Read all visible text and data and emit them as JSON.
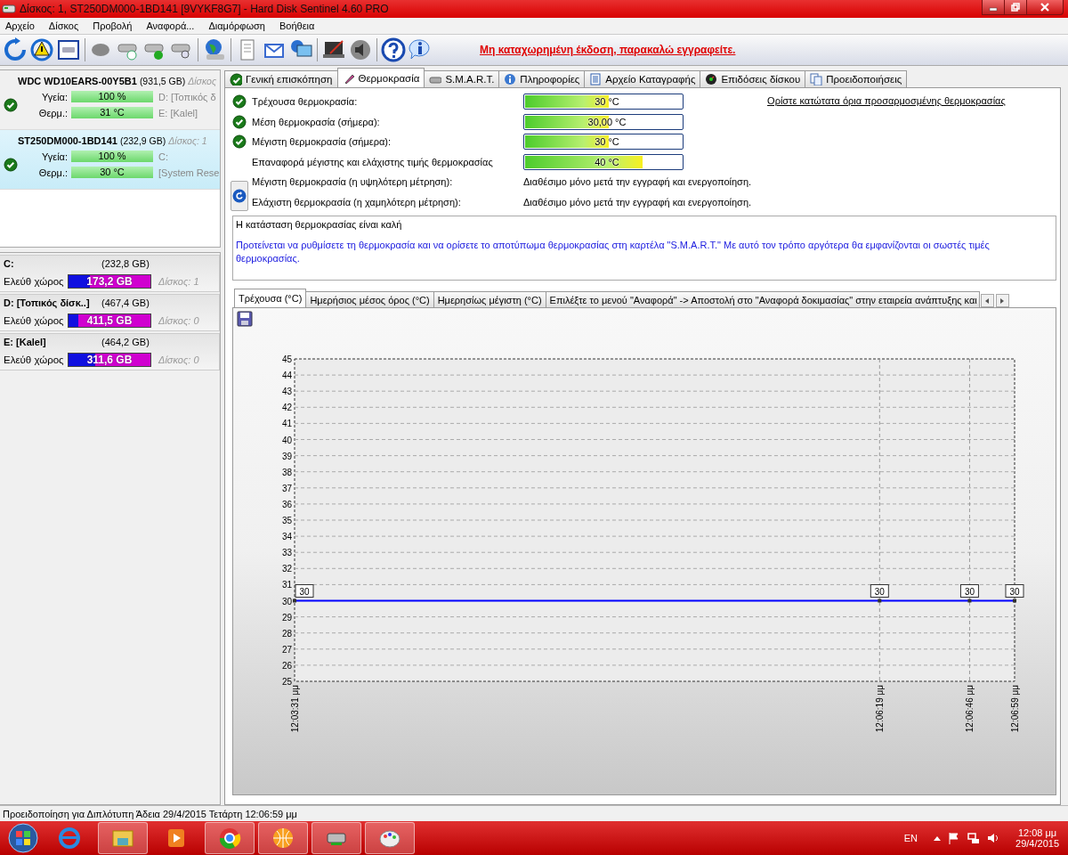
{
  "window": {
    "title": "Δίσκος: 1, ST250DM000-1BD141 [9VYKF8G7]  -  Hard Disk Sentinel 4.60 PRO"
  },
  "menu": [
    "Αρχείο",
    "Δίσκος",
    "Προβολή",
    "Αναφορά...",
    "Διαμόρφωση",
    "Βοήθεια"
  ],
  "toolbar": {
    "notice": "Μη καταχωρημένη έκδοση, παρακαλώ εγγραφείτε."
  },
  "disks": [
    {
      "name": "WDC WD10EARS-00Y5B1",
      "size": "(931,5 GB)",
      "disk": "Δίσκος",
      "selected": false,
      "healthy": true,
      "health_label": "Υγεία:",
      "health": "100 %",
      "temp_label": "Θερμ.:",
      "temp": "31 °C",
      "partitions": [
        "D: [Τοπικός δ",
        "E: [Kalel]"
      ]
    },
    {
      "name": "ST250DM000-1BD141",
      "size": "(232,9 GB)",
      "disk": "Δίσκος: 1",
      "selected": true,
      "healthy": true,
      "health_label": "Υγεία:",
      "health": "100 %",
      "temp_label": "Θερμ.:",
      "temp": "30 °C",
      "partitions": [
        "C:",
        "[System Rese"
      ]
    }
  ],
  "volumes": [
    {
      "name": "C:",
      "size": "(232,8 GB)",
      "free_label": "Ελεύθ χώρος",
      "free": "173,2 GB",
      "level": 0.26,
      "disk": "Δίσκος: 1"
    },
    {
      "name": "D: [Τοπικός δίσκ..]",
      "size": "(467,4 GB)",
      "free_label": "Ελεύθ χώρος",
      "free": "411,5 GB",
      "level": 0.12,
      "disk": "Δίσκος: 0"
    },
    {
      "name": "E: [Kalel]",
      "size": "(464,2 GB)",
      "free_label": "Ελεύθ χώρος",
      "free": "311,6 GB",
      "level": 0.33,
      "disk": "Δίσκος: 0"
    }
  ],
  "tabs": [
    {
      "label": "Γενική επισκόπηση",
      "selected": false
    },
    {
      "label": "Θερμοκρασία",
      "selected": true
    },
    {
      "label": "S.M.A.R.T.",
      "selected": false
    },
    {
      "label": "Πληροφορίες",
      "selected": false
    },
    {
      "label": "Αρχείο Καταγραφής",
      "selected": false
    },
    {
      "label": "Επιδόσεις δίσκου",
      "selected": false
    },
    {
      "label": "Προειδοποιήσεις",
      "selected": false
    }
  ],
  "temperature": {
    "rows": [
      {
        "kind": "bar",
        "healthy": true,
        "label": "Τρέχουσα θερμοκρασία:",
        "value": "30 °C",
        "level": 0.53
      },
      {
        "kind": "bar",
        "healthy": true,
        "label": "Μέση θερμοκρασία (σήμερα):",
        "value": "30,00 °C",
        "level": 0.53
      },
      {
        "kind": "bar",
        "healthy": true,
        "label": "Μέγιστη θερμοκρασία (σήμερα):",
        "value": "30 °C",
        "level": 0.53
      },
      {
        "kind": "bar",
        "healthy": false,
        "label": "Επαναφορά μέγιστης και ελάχιστης τιμής θερμοκρασίας",
        "value": "40 °C",
        "level": 0.74
      },
      {
        "kind": "text",
        "label": "Μέγιστη θερμοκρασία (η υψηλότερη μέτρηση):",
        "value": "Διαθέσιμο μόνο μετά την εγγραφή και ενεργοποίηση."
      },
      {
        "kind": "text",
        "label": "Ελάχιστη θερμοκρασία (η χαμηλότερη μέτρηση):",
        "value": "Διαθέσιμο μόνο μετά την εγγραφή και ενεργοποίηση."
      }
    ],
    "limits_link": "Ορίστε κατώτατα όρια προσαρμοσμένης θερμοκρασίας",
    "status_text": "Η κατάσταση θερμοκρασίας είναι καλή",
    "advice": "Προτείνεται να ρυθμίσετε τη θερμοκρασία και να ορίσετε το αποτύπωμα θερμοκρασίας στη καρτέλα \"S.M.A.R.T.\" Με αυτό τον τρόπο αργότερα θα εμφανίζονται οι σωστές τιμές θερμοκρασίας."
  },
  "chart_tabs": [
    {
      "label": "Τρέχουσα (°C)",
      "selected": true
    },
    {
      "label": "Ημερήσιος μέσος όρος (°C)",
      "selected": false
    },
    {
      "label": "Ημερησίως μέγιστη (°C)",
      "selected": false
    },
    {
      "label": "Επιλέξτε το μενού \"Αναφορά\" -> Αποστολή στο \"Αναφορά δοκιμασίας\" στην εταιρεία ανάπτυξης και",
      "selected": false
    }
  ],
  "chart_data": {
    "type": "line",
    "categories": [
      "12:03:31 μμ",
      null,
      null,
      null,
      null,
      null,
      null,
      null,
      null,
      null,
      null,
      null,
      null,
      "12:06:19 μμ",
      null,
      "12:06:46 μμ",
      "12:06:59 μμ"
    ],
    "series": [
      {
        "color": "#0000ff",
        "marker": "square",
        "values": [
          30,
          null,
          null,
          null,
          null,
          null,
          null,
          null,
          null,
          null,
          null,
          null,
          null,
          30,
          null,
          30,
          30
        ]
      }
    ],
    "ylim": [
      25,
      45
    ],
    "grid": true,
    "yticks": [
      25,
      26,
      27,
      28,
      29,
      30,
      31,
      32,
      33,
      34,
      35,
      36,
      37,
      38,
      39,
      40,
      41,
      42,
      43,
      44,
      45
    ],
    "data_labels": true
  },
  "status_bar": "Προειδοποίηση για Διπλότυπη  Άδεια 29/4/2015 Τετάρτη 12:06:59 μμ",
  "taskbar": {
    "language": "EN",
    "time": "12:08 μμ",
    "date": "29/4/2015"
  }
}
